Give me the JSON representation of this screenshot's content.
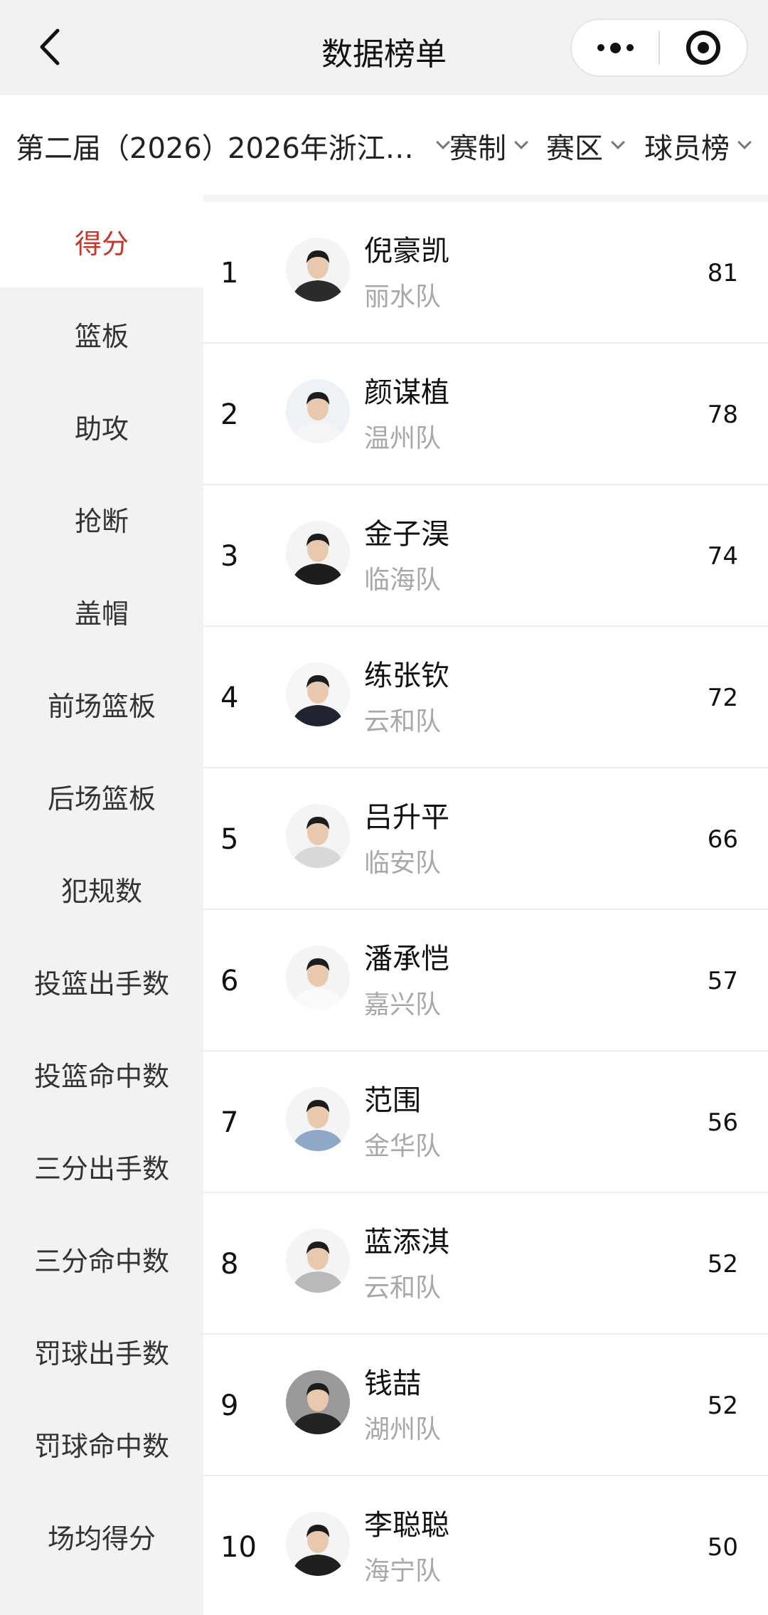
{
  "header": {
    "title": "数据榜单"
  },
  "filters": {
    "season": "第二届（2026）",
    "league": "2026年浙江…",
    "format": "赛制",
    "region": "赛区",
    "board": "球员榜"
  },
  "sidebar": {
    "items": [
      {
        "label": "得分",
        "active": true
      },
      {
        "label": "篮板"
      },
      {
        "label": "助攻"
      },
      {
        "label": "抢断"
      },
      {
        "label": "盖帽"
      },
      {
        "label": "前场篮板"
      },
      {
        "label": "后场篮板"
      },
      {
        "label": "犯规数"
      },
      {
        "label": "投篮出手数"
      },
      {
        "label": "投篮命中数"
      },
      {
        "label": "三分出手数"
      },
      {
        "label": "三分命中数"
      },
      {
        "label": "罚球出手数"
      },
      {
        "label": "罚球命中数"
      },
      {
        "label": "场均得分"
      }
    ]
  },
  "ranking": [
    {
      "rank": "1",
      "name": "倪豪凯",
      "team": "丽水队",
      "value": "81",
      "shirt": "#2b2b2b",
      "bg": "#f4f4f4"
    },
    {
      "rank": "2",
      "name": "颜谋植",
      "team": "温州队",
      "value": "78",
      "shirt": "#f5f5f5",
      "bg": "#eef2f6"
    },
    {
      "rank": "3",
      "name": "金子淏",
      "team": "临海队",
      "value": "74",
      "shirt": "#1d1d1d",
      "bg": "#f4f4f4"
    },
    {
      "rank": "4",
      "name": "练张钦",
      "team": "云和队",
      "value": "72",
      "shirt": "#1f2430",
      "bg": "#f6f6f6"
    },
    {
      "rank": "5",
      "name": "吕升平",
      "team": "临安队",
      "value": "66",
      "shirt": "#d8d8d8",
      "bg": "#f4f4f4"
    },
    {
      "rank": "6",
      "name": "潘承恺",
      "team": "嘉兴队",
      "value": "57",
      "shirt": "#fafafa",
      "bg": "#f4f4f4"
    },
    {
      "rank": "7",
      "name": "范围",
      "team": "金华队",
      "value": "56",
      "shirt": "#8fa8c8",
      "bg": "#f4f4f4"
    },
    {
      "rank": "8",
      "name": "蓝添淇",
      "team": "云和队",
      "value": "52",
      "shirt": "#b9b9b9",
      "bg": "#f4f4f4"
    },
    {
      "rank": "9",
      "name": "钱喆",
      "team": "湖州队",
      "value": "52",
      "shirt": "#222222",
      "bg": "#9a9a9a"
    },
    {
      "rank": "10",
      "name": "李聪聪",
      "team": "海宁队",
      "value": "50",
      "shirt": "#1f1f1f",
      "bg": "#f4f4f4"
    }
  ],
  "colors": {
    "accent": "#c0392b",
    "sidebar_bg": "#f2f2f2",
    "team_text": "#a8a8a8"
  }
}
